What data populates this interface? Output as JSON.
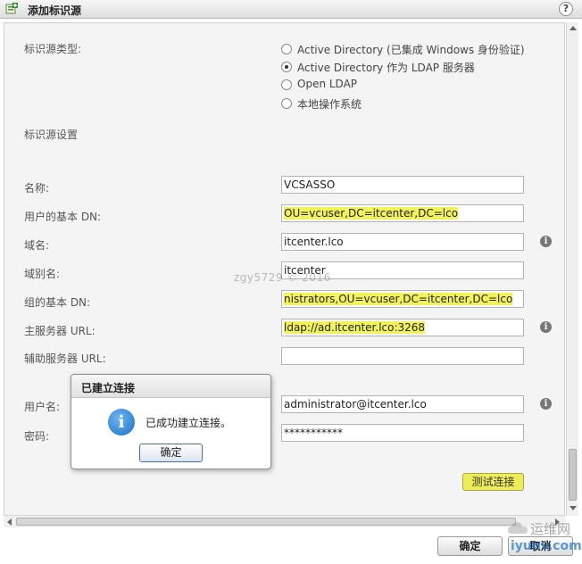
{
  "dialog": {
    "title": "添加标识源",
    "help": "?"
  },
  "source_type": {
    "label": "标识源类型:",
    "options": [
      {
        "label": "Active Directory (已集成 Windows 身份验证)",
        "checked": false
      },
      {
        "label": "Active Directory 作为 LDAP 服务器",
        "checked": true
      },
      {
        "label": "Open LDAP",
        "checked": false
      },
      {
        "label": "本地操作系统",
        "checked": false
      }
    ]
  },
  "settings_label": "标识源设置",
  "fields": {
    "name": {
      "label": "名称:",
      "value": "VCSASSO"
    },
    "user_base_dn": {
      "label": "用户的基本 DN:",
      "value": "OU=vcuser,DC=itcenter,DC=lco"
    },
    "domain_name": {
      "label": "域名:",
      "value": "itcenter.lco"
    },
    "domain_alias": {
      "label": "域别名:",
      "value": "itcenter"
    },
    "group_base_dn": {
      "label": "组的基本 DN:",
      "value": "nistrators,OU=vcuser,DC=itcenter,DC=lco"
    },
    "primary_url": {
      "label": "主服务器 URL:",
      "value": "ldap://ad.itcenter.lco:3268"
    },
    "secondary_url": {
      "label": "辅助服务器 URL:",
      "value": ""
    },
    "username": {
      "label": "用户名:",
      "value": "administrator@itcenter.lco"
    },
    "password": {
      "label": "密码:",
      "value": "***********"
    }
  },
  "test_connection": "测试连接",
  "footer": {
    "ok": "确定",
    "cancel": "取消"
  },
  "popup": {
    "title": "已建立连接",
    "message": "已成功建立连接。",
    "ok": "确定"
  },
  "watermark": "zgy5729 © 2016",
  "site_logo": {
    "cn": "运维网",
    "en": "iyunv.com"
  },
  "colors": {
    "highlight": "#f2f25a",
    "info_blue": "#1a6fc7"
  }
}
